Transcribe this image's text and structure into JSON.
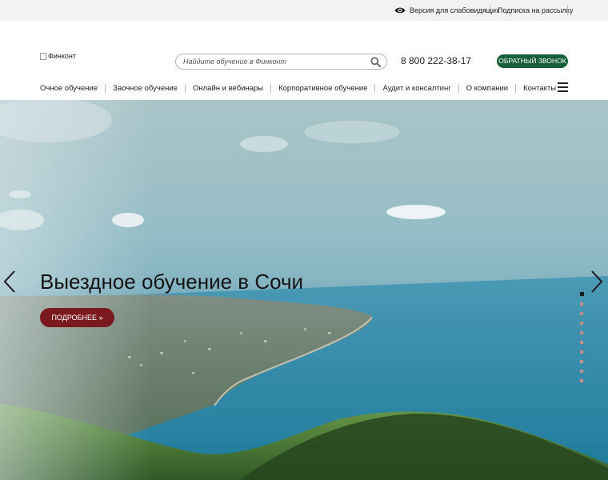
{
  "topbar": {
    "vision_label": "Версия для слабовидящих",
    "subscribe_label": "Подписка на рассылку"
  },
  "header": {
    "logo_alt": "Финконт",
    "search": {
      "placeholder": "Найдите обучение в Финконт"
    },
    "phone": "8 800 222-38-17",
    "callback_label": "ОБРАТНЫЙ ЗВОНОК"
  },
  "nav": {
    "items": [
      {
        "label": "Очное обучение"
      },
      {
        "label": "Заочное обучение"
      },
      {
        "label": "Онлайн и вебинары"
      },
      {
        "label": "Корпоративное обучение"
      },
      {
        "label": "Аудит и консалтинг"
      },
      {
        "label": "О компании"
      },
      {
        "label": "Контакты"
      }
    ]
  },
  "hero": {
    "title": "Выездное обучение в Сочи",
    "button_label": "ПОДРОБНЕЕ »",
    "slide_count": 10,
    "active_slide": 1
  },
  "colors": {
    "accent_green": "#175e3a",
    "accent_red": "#7a1a1f",
    "topbar_bg": "#f2f2f2"
  },
  "icons": {
    "vision": "eye-icon",
    "search": "search-icon",
    "menu": "hamburger-menu-icon",
    "prev": "chevron-left-icon",
    "next": "chevron-right-icon"
  }
}
